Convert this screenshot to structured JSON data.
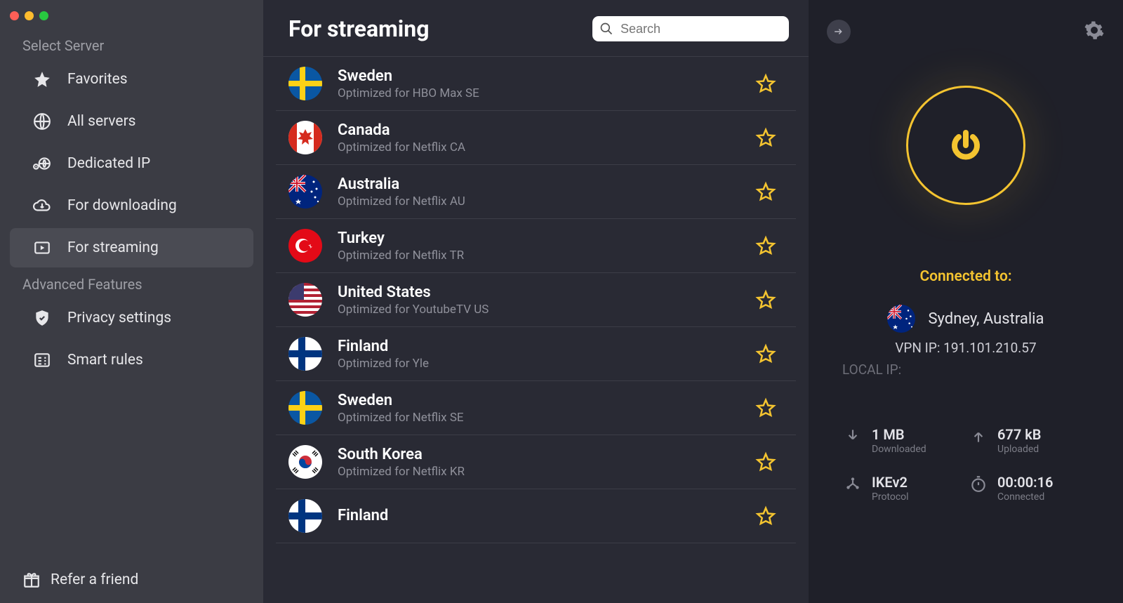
{
  "sidebar": {
    "section1_label": "Select Server",
    "items": [
      {
        "label": "Favorites"
      },
      {
        "label": "All servers"
      },
      {
        "label": "Dedicated IP"
      },
      {
        "label": "For downloading"
      },
      {
        "label": "For streaming"
      }
    ],
    "section2_label": "Advanced Features",
    "adv_items": [
      {
        "label": "Privacy settings"
      },
      {
        "label": "Smart rules"
      }
    ],
    "refer_label": "Refer a friend"
  },
  "main": {
    "title": "For streaming",
    "search_placeholder": "Search",
    "servers": [
      {
        "name": "Sweden",
        "sub": "Optimized for HBO Max SE",
        "flag": "se"
      },
      {
        "name": "Canada",
        "sub": "Optimized for Netflix CA",
        "flag": "ca"
      },
      {
        "name": "Australia",
        "sub": "Optimized for Netflix AU",
        "flag": "au"
      },
      {
        "name": "Turkey",
        "sub": "Optimized for Netflix TR",
        "flag": "tr"
      },
      {
        "name": "United States",
        "sub": "Optimized for YoutubeTV US",
        "flag": "us"
      },
      {
        "name": "Finland",
        "sub": "Optimized for Yle",
        "flag": "fi"
      },
      {
        "name": "Sweden",
        "sub": "Optimized for Netflix SE",
        "flag": "se"
      },
      {
        "name": "South Korea",
        "sub": "Optimized for Netflix KR",
        "flag": "kr"
      },
      {
        "name": "Finland",
        "sub": "",
        "flag": "fi"
      }
    ]
  },
  "panel": {
    "connected_label": "Connected to:",
    "location": "Sydney, Australia",
    "location_flag": "au",
    "vpn_ip_label": "VPN IP:",
    "vpn_ip": "191.101.210.57",
    "local_ip_label": "LOCAL IP:",
    "stats": {
      "downloaded_val": "1 MB",
      "downloaded_lab": "Downloaded",
      "uploaded_val": "677 kB",
      "uploaded_lab": "Uploaded",
      "protocol_val": "IKEv2",
      "protocol_lab": "Protocol",
      "connected_val": "00:00:16",
      "connected_lab": "Connected"
    }
  }
}
